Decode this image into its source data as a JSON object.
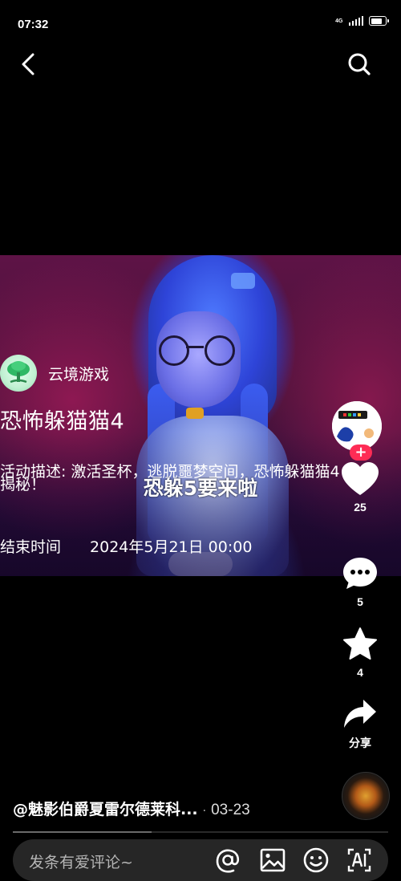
{
  "status_bar": {
    "time": "07:32",
    "network": "4G",
    "battery_level": 0.85
  },
  "author": {
    "name": "云境游戏"
  },
  "post": {
    "title": "恐怖躲猫猫4",
    "description_line1": "活动描述: 激活圣杯，逃脱噩梦空间，恐怖躲猫猫4",
    "description_line2": "揭秘！",
    "video_caption": "恐躲5要来啦",
    "end_time_label": "结束时间",
    "end_time_value": "2024年5月21日 00:00"
  },
  "actions": {
    "follow_label": "+",
    "likes": "25",
    "comments": "5",
    "favorites": "4",
    "share_label": "分享"
  },
  "footer": {
    "handle": "@魅影伯爵夏雷尔德莱科...",
    "separator": "·",
    "date": "03-23",
    "progress": 0.37
  },
  "comment_bar": {
    "placeholder": "发条有爱评论~"
  },
  "icons": {
    "back": "back-arrow-icon",
    "search": "search-icon",
    "like": "heart-icon",
    "comment": "comment-bubble-icon",
    "favorite": "star-icon",
    "share": "share-arrow-icon",
    "at": "at-sign-icon",
    "image": "image-icon",
    "emoji": "emoji-icon",
    "ai": "ai-icon"
  },
  "colors": {
    "follow": "#fe2c55",
    "background": "#000000",
    "comment_bar": "#262626"
  }
}
